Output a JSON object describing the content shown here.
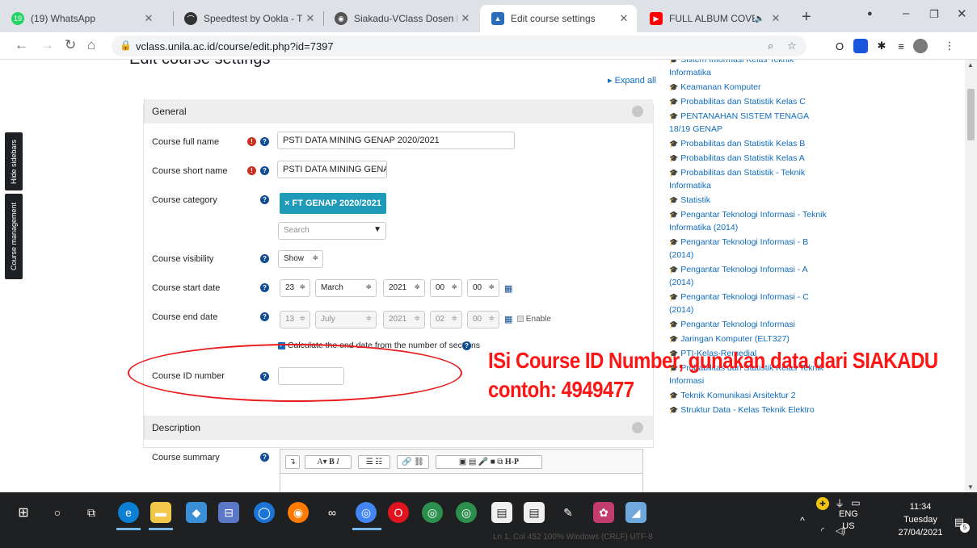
{
  "browser": {
    "tabs": [
      {
        "label": "(19) WhatsApp",
        "icon": "whatsapp-icon",
        "badge": "19",
        "color": "#25d366"
      },
      {
        "label": "Speedtest by Ookla - The Glo",
        "icon": "speedtest-icon",
        "color": "#333333"
      },
      {
        "label": "Siakadu-VClass Dosen Pengaj",
        "icon": "globe-icon",
        "color": "#555555"
      },
      {
        "label": "Edit course settings",
        "icon": "moodle-icon",
        "color": "#2a6ebb"
      },
      {
        "label": "FULL ALBUM COVER FELI",
        "icon": "youtube-icon",
        "color": "#ff0000"
      }
    ],
    "url": "vclass.unila.ac.id/course/edit.php?id=7397"
  },
  "sidebar_tabs": {
    "hide": "Hide sidebars",
    "course_mgmt": "Course management"
  },
  "page": {
    "heading": "Edit course settings",
    "expand_all": "Expand all"
  },
  "general": {
    "title": "General",
    "full_name_label": "Course full name",
    "full_name_value": "PSTI DATA MINING GENAP 2020/2021",
    "short_name_label": "Course short name",
    "short_name_value": "PSTI DATA MINING GENA",
    "category_label": "Course category",
    "category_value": "× FT GENAP 2020/2021",
    "search_placeholder": "Search",
    "visibility_label": "Course visibility",
    "visibility_value": "Show",
    "start_label": "Course start date",
    "start": {
      "day": "23",
      "month": "March",
      "year": "2021",
      "hour": "00",
      "minute": "00"
    },
    "end_label": "Course end date",
    "end": {
      "day": "13",
      "month": "July",
      "year": "2021",
      "hour": "02",
      "minute": "00",
      "enable": "Enable"
    },
    "calc_label": "Calculate the end date from the number of sections",
    "id_label": "Course ID number",
    "id_value": ""
  },
  "description": {
    "title": "Description",
    "summary_label": "Course summary",
    "toolbar": [
      "↴",
      "A▾",
      "B",
      "I",
      "☰",
      "☷",
      "🔗",
      "⛓",
      "▣",
      "▤",
      "🎤",
      "■",
      "⧉",
      "H-P"
    ]
  },
  "annotation": {
    "line1": "ISi Course ID Number, gunakan data dari SIAKADU",
    "line2": "contoh: 4949477"
  },
  "course_list": [
    "Sistem Informasi Kelas Teknik Informatika",
    "Keamanan Komputer",
    "Probabilitas dan Statistik Kelas C",
    "PENTANAHAN SISTEM TENAGA 18/19 GENAP",
    "Probabilitas dan Statistik Kelas B",
    "Probabilitas dan Statistik Kelas A",
    "Probabilitas dan Statistik - Teknik Informatika",
    "Statistik",
    "Pengantar Teknologi Informasi - Teknik Informatika (2014)",
    "Pengantar Teknologi Informasi - B (2014)",
    "Pengantar Teknologi Informasi - A (2014)",
    "Pengantar Teknologi Informasi - C (2014)",
    "Pengantar Teknologi Informasi",
    "Jaringan Komputer (ELT327)",
    "PTI-Kelas-Remedial",
    "Probabilitas dan Statistik Kelas Teknik Informasi",
    "Teknik Komunikasi Arsitektur 2",
    "Struktur Data - Kelas Teknik Elektro"
  ],
  "taskbar": {
    "lang": "ENG",
    "region": "US",
    "time": "11:34",
    "day": "Tuesday",
    "date": "27/04/2021",
    "notif_count": "5",
    "notepad_status": "Ln 1, Col 452          100%      Windows (CRLF)      UTF-8"
  }
}
